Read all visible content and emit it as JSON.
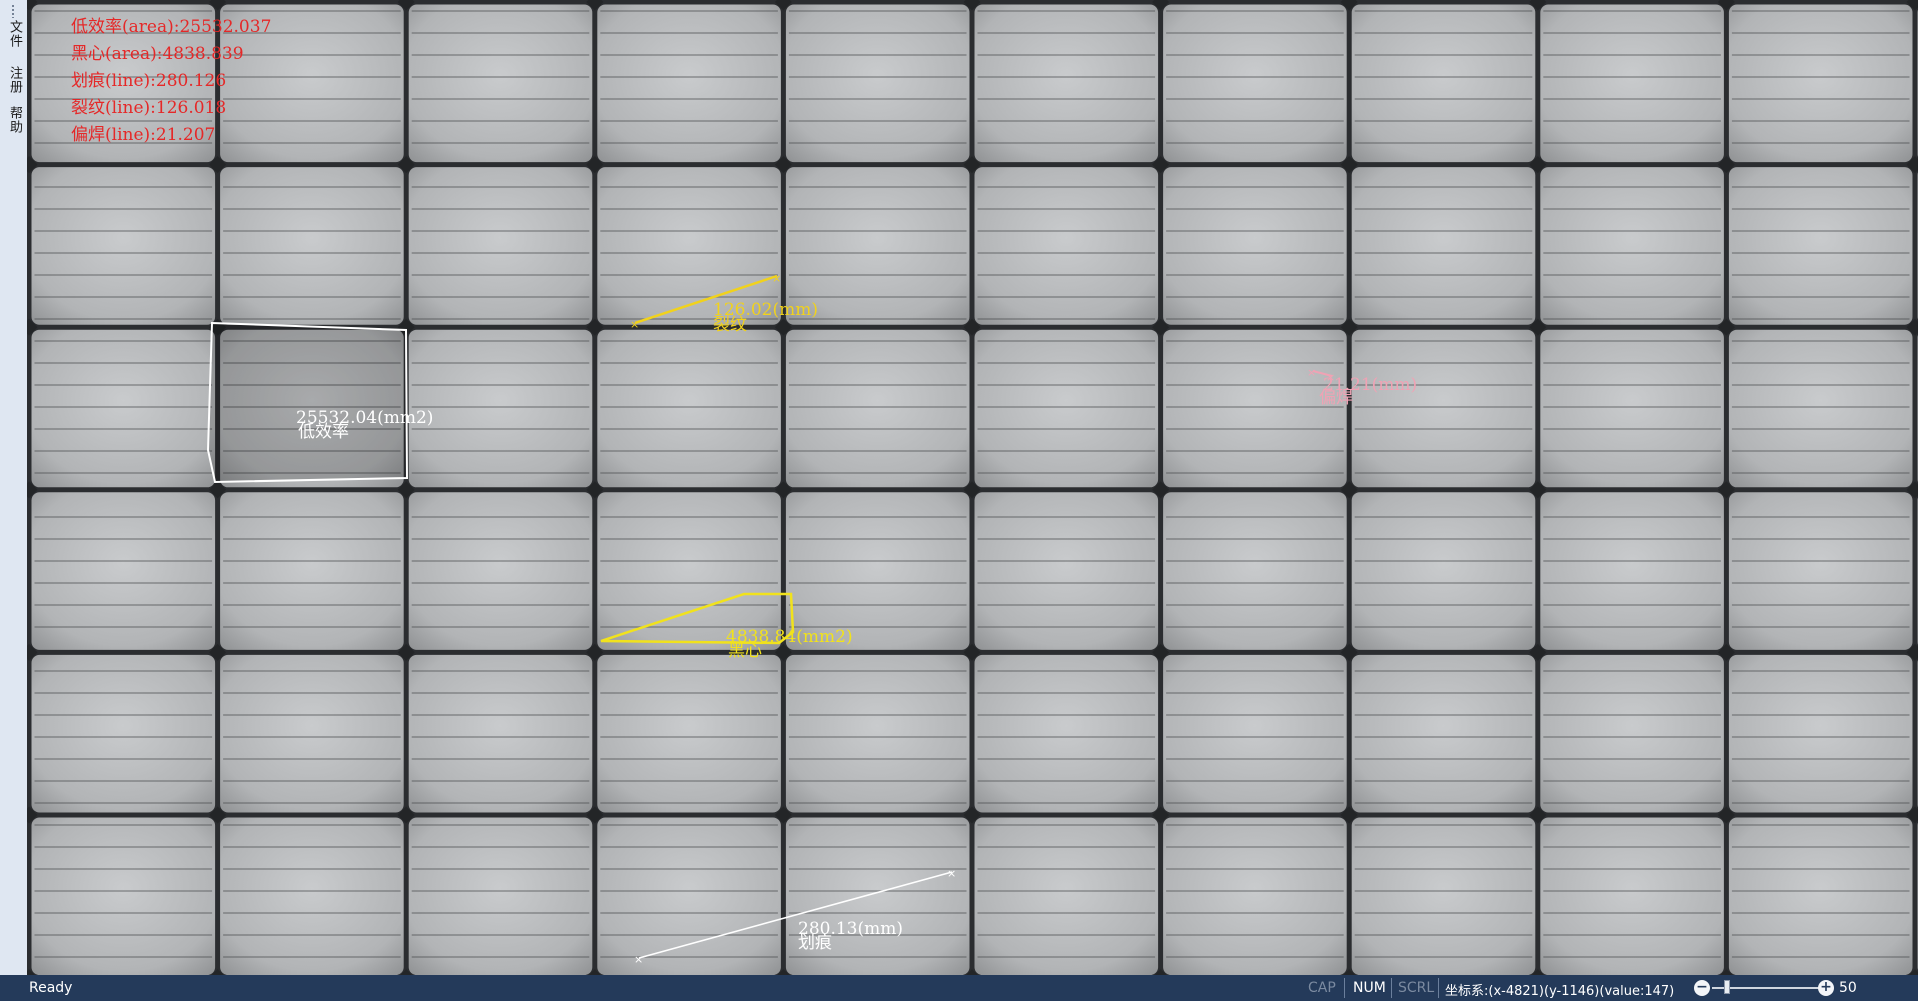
{
  "menu": [
    "文件",
    "注册",
    "帮助"
  ],
  "stats": [
    "低效率(area):25532.037",
    "黑心(area):4838.839",
    "划痕(line):280.126",
    "裂纹(line):126.018",
    "偏焊(line):21.207"
  ],
  "annotations": {
    "low_efficiency": {
      "value": "25532.04(mm2)",
      "label": "低效率"
    },
    "crack": {
      "value": "126.02(mm)",
      "label": "裂纹"
    },
    "black_core": {
      "value": "4838.84(mm2)",
      "label": "黑心"
    },
    "scratch": {
      "value": "280.13(mm)",
      "label": "划痕"
    },
    "offset_weld": {
      "value": "21.21(mm)",
      "label": "偏焊"
    }
  },
  "colors": {
    "stats_text": "#e52828",
    "low_efficiency": "#ffffff",
    "crack": "#f1d21c",
    "black_core": "#f1e21c",
    "scratch": "#ffffff",
    "offset_weld": "#f0a2b4",
    "statusbar": "#243a5a"
  },
  "status": {
    "ready": "Ready",
    "cap": "CAP",
    "num": "NUM",
    "scrl": "SCRL",
    "coords": "坐标系:(x-4821)(y-1146)(value:147)",
    "zoom": "50"
  }
}
